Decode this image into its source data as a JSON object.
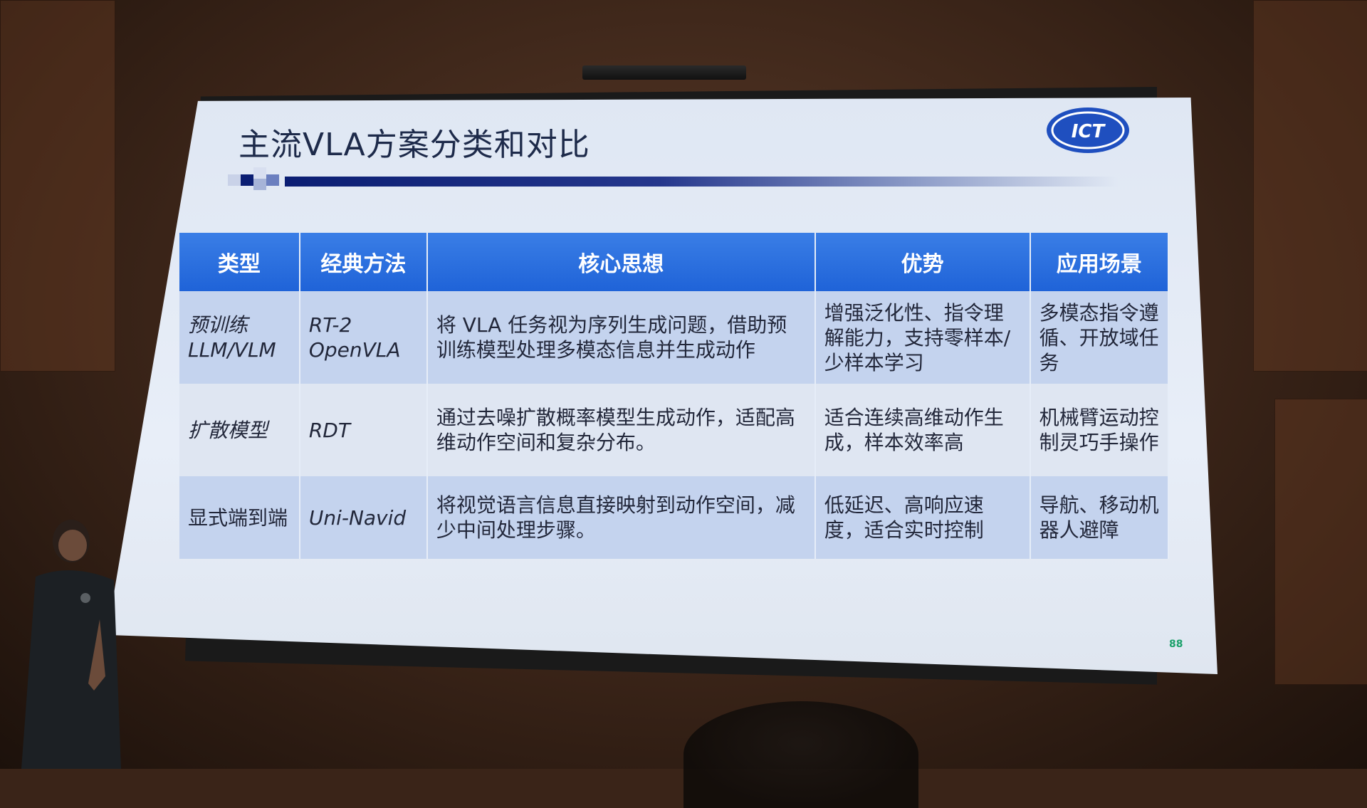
{
  "slide": {
    "title": "主流VLA方案分类和对比",
    "logo_text": "ICT",
    "page_number": "88",
    "brand_colors": {
      "header_blue": "#1f63d8",
      "title_bar_navy": "#0b1e73",
      "row_band": "#c4d3ee"
    }
  },
  "table": {
    "headers": [
      "类型",
      "经典方法",
      "核心思想",
      "优势",
      "应用场景"
    ],
    "rows": [
      {
        "type": "预训练\nLLM/VLM",
        "method": "RT-2\nOpenVLA",
        "core": "将 VLA 任务视为序列生成问题，借助预训练模型处理多模态信息并生成动作",
        "advantage": "增强泛化性、指令理解能力，支持零样本/少样本学习",
        "scenario": "多模态指令遵循、开放域任务"
      },
      {
        "type": "扩散模型",
        "method": "RDT",
        "core": "通过去噪扩散概率模型生成动作，适配高维动作空间和复杂分布。",
        "advantage": "适合连续高维动作生成，样本效率高",
        "scenario": "机械臂运动控制灵巧手操作"
      },
      {
        "type": "显式端到端",
        "method": "Uni-Navid",
        "core": "将视觉语言信息直接映射到动作空间，减少中间处理步骤。",
        "advantage": "低延迟、高响应速度，适合实时控制",
        "scenario": "导航、移动机器人避障"
      }
    ]
  }
}
